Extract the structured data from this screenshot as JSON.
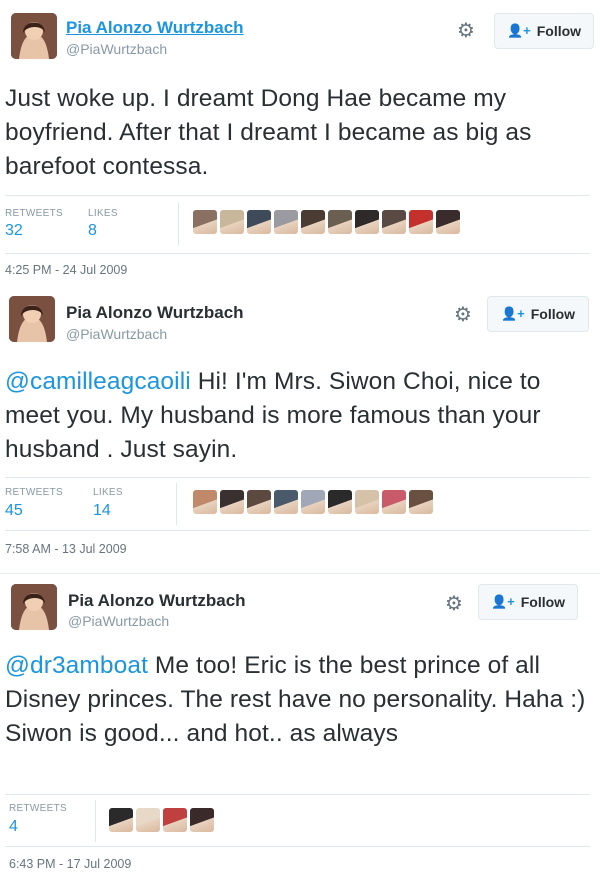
{
  "tweets": [
    {
      "name": "Pia Alonzo Wurtzbach",
      "handle": "@PiaWurtzbach",
      "follow_label": "Follow",
      "text_parts": [
        "",
        "Just woke up. I dreamt Dong Hae became my boyfriend. After that I dreamt I became as big as barefoot contessa."
      ],
      "retweets_label": "RETWEETS",
      "retweets": "32",
      "likes_label": "LIKES",
      "likes": "8",
      "timestamp": "4:25 PM - 24 Jul 2009",
      "faces": [
        "#8a7060",
        "#c9b79c",
        "#3f4b5a",
        "#9a9aa0",
        "#4a3b33",
        "#6b5f52",
        "#2e2a2a",
        "#5a4a44",
        "#c4302b",
        "#3a2c2c"
      ]
    },
    {
      "name": "Pia Alonzo Wurtzbach",
      "handle": "@PiaWurtzbach",
      "follow_label": "Follow",
      "text_parts": [
        "@camilleagcaoili",
        " Hi! I'm Mrs. Siwon Choi, nice to meet you. My husband is more famous than your husband . Just sayin."
      ],
      "retweets_label": "RETWEETS",
      "retweets": "45",
      "likes_label": "LIKES",
      "likes": "14",
      "timestamp": "7:58 AM - 13 Jul 2009",
      "faces": [
        "#c08a6a",
        "#3a3030",
        "#5c4a40",
        "#4a5a6a",
        "#a0a8b8",
        "#2a2a2a",
        "#d6c2a8",
        "#c85a6a",
        "#6a5040"
      ]
    },
    {
      "name": "Pia Alonzo Wurtzbach",
      "handle": "@PiaWurtzbach",
      "follow_label": "Follow",
      "text_parts": [
        "@dr3amboat",
        " Me too! Eric is the best prince of all Disney princes. The rest have no personality. Haha :) Siwon is good... and hot.. as always"
      ],
      "retweets_label": "RETWEETS",
      "retweets": "4",
      "timestamp": "6:43 PM - 17 Jul 2009",
      "faces": [
        "#2a2a2a",
        "#e8d8c8",
        "#c04040",
        "#3a2a2a"
      ]
    }
  ],
  "colors": {
    "link": "#1b95e0",
    "muted": "#8899a6",
    "text": "#292f33"
  },
  "icons": {
    "gear": "gear-icon",
    "follow": "add-person-icon"
  }
}
